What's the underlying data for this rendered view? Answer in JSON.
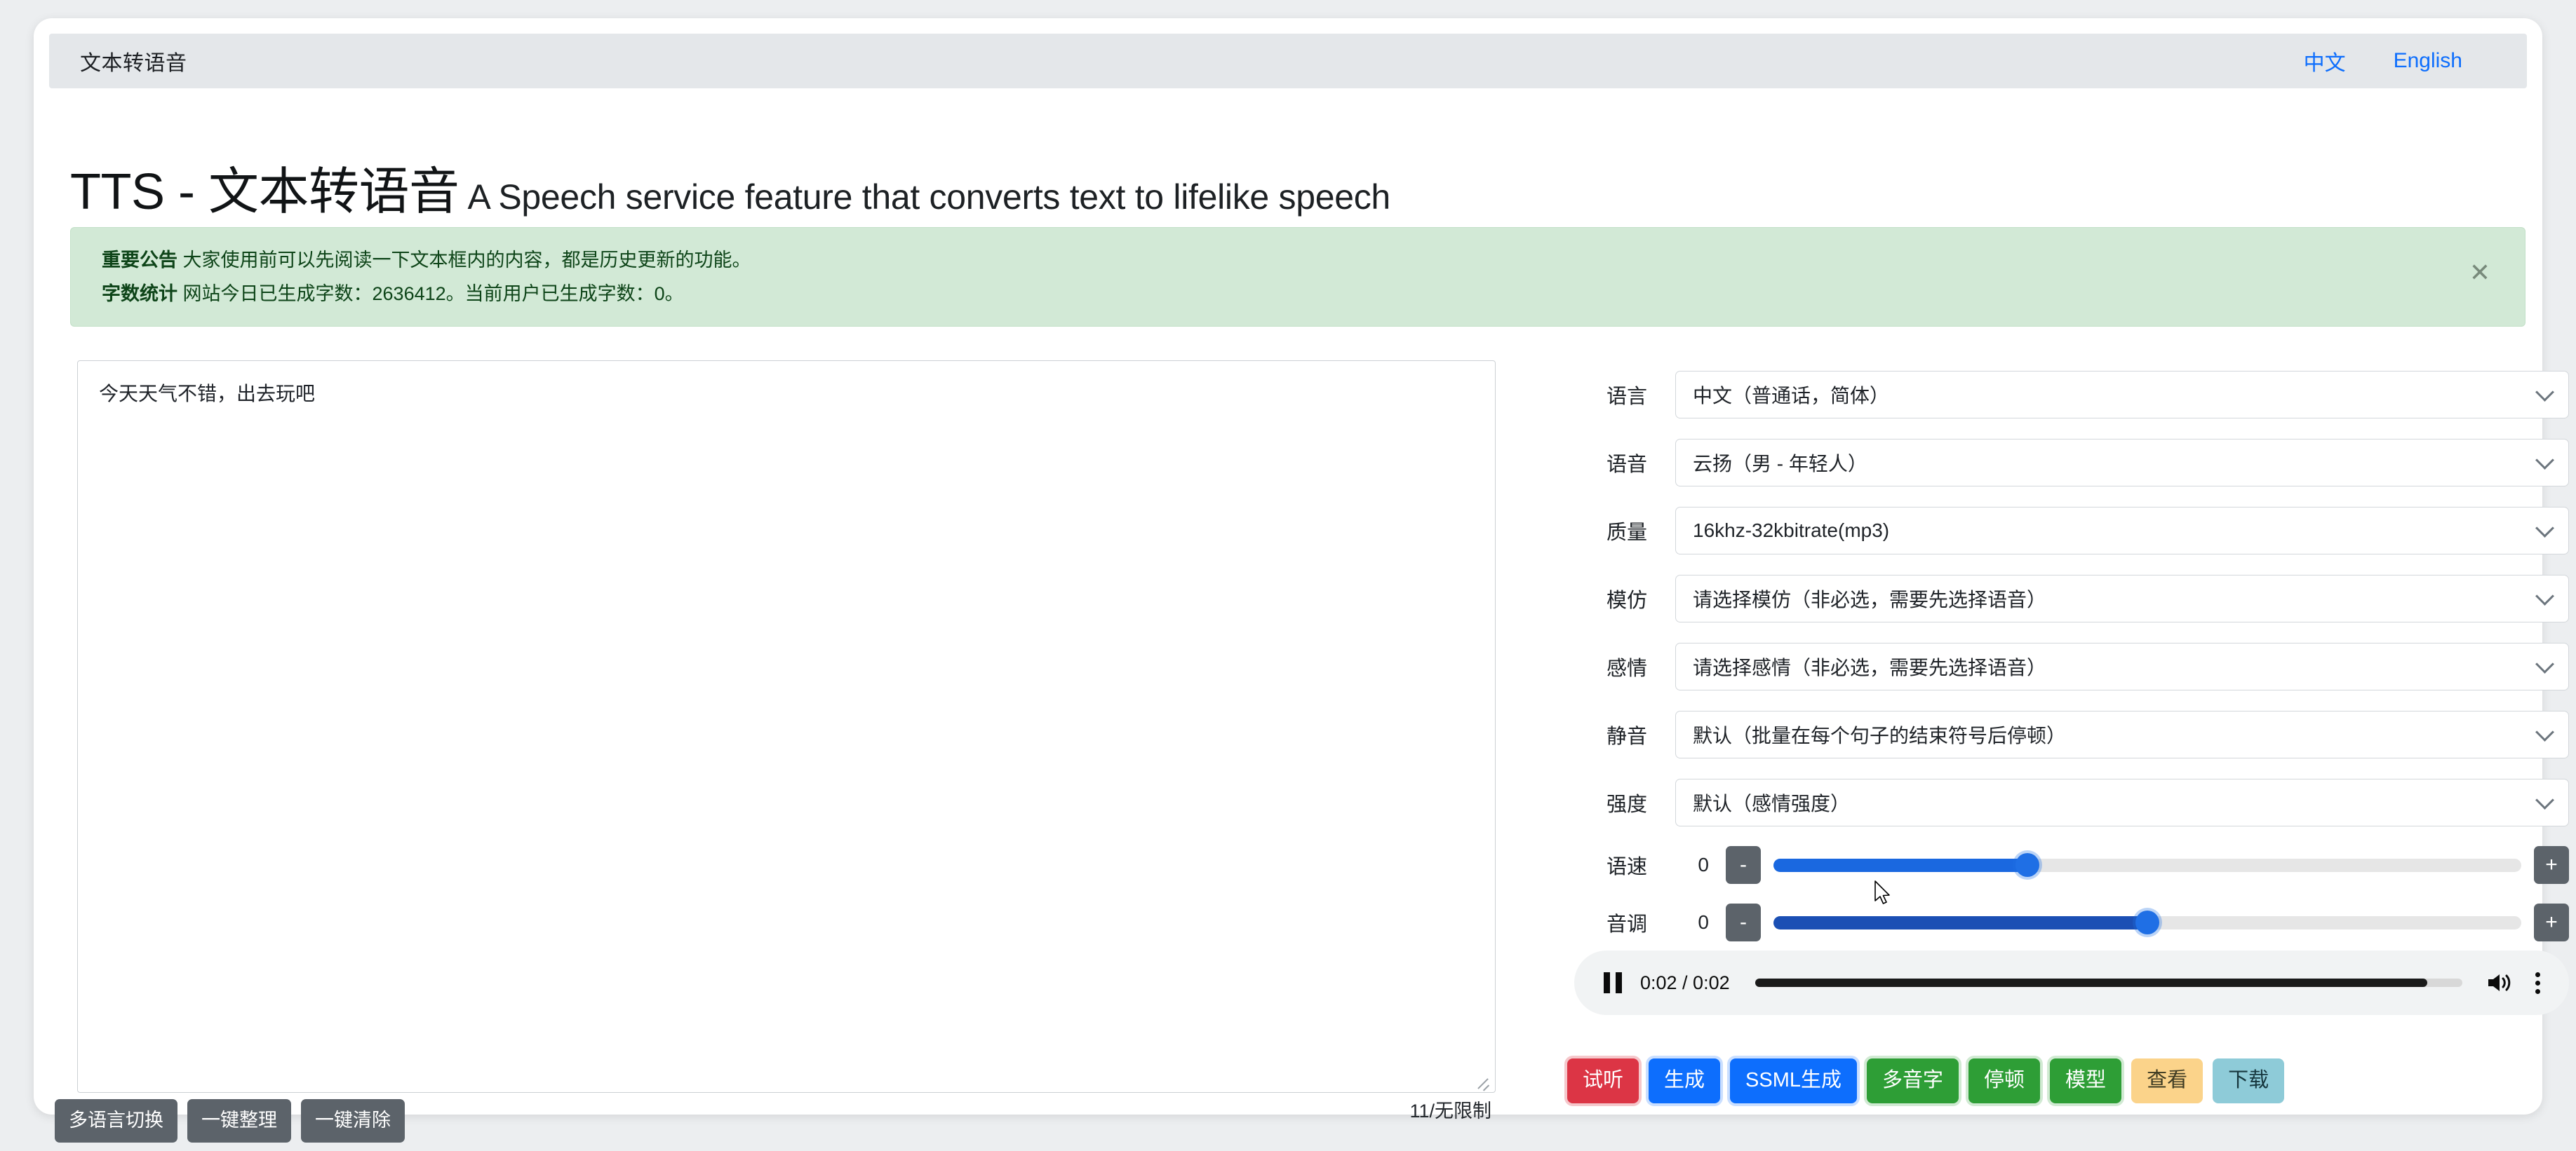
{
  "navbar": {
    "brand": "文本转语音",
    "links": [
      {
        "label": "中文"
      },
      {
        "label": "English"
      }
    ]
  },
  "heading": {
    "main": "TTS - 文本转语音",
    "sub": "A Speech service feature that converts text to lifelike speech"
  },
  "alert": {
    "line1_strong": "重要公告",
    "line1_text": "大家使用前可以先阅读一下文本框内的内容，都是历史更新的功能。",
    "line2_strong": "字数统计",
    "line2_text": "网站今日已生成字数：2636412。当前用户已生成字数：0。",
    "close_label": "✕",
    "background_color": "#d2e9d6"
  },
  "editor": {
    "text_value": "今天天气不错，出去玩吧",
    "placeholder": "",
    "char_counter": "11/无限制",
    "tools": [
      {
        "label": "多语言切换"
      },
      {
        "label": "一键整理"
      },
      {
        "label": "一键清除"
      }
    ]
  },
  "controls": {
    "selects": [
      {
        "label": "语言",
        "value": "中文（普通话，简体）"
      },
      {
        "label": "语音",
        "value": "云扬（男 - 年轻人）"
      },
      {
        "label": "质量",
        "value": "16khz-32kbitrate(mp3)"
      },
      {
        "label": "模仿",
        "value": "请选择模仿（非必选，需要先选择语音）"
      },
      {
        "label": "感情",
        "value": "请选择感情（非必选，需要先选择语音）"
      },
      {
        "label": "静音",
        "value": "默认（批量在每个句子的结束符号后停顿）"
      },
      {
        "label": "强度",
        "value": "默认（感情强度）"
      }
    ],
    "sliders": [
      {
        "label": "语速",
        "value": "0",
        "percent": 34,
        "minus_label": "-",
        "plus_label": "+"
      },
      {
        "label": "音调",
        "value": "0",
        "percent": 50,
        "minus_label": "-",
        "plus_label": "+"
      }
    ]
  },
  "audio": {
    "state": "playing",
    "time": "0:02 / 0:02",
    "progress_percent": 95
  },
  "actions": [
    {
      "label": "试听",
      "style": "btn-danger"
    },
    {
      "label": "生成",
      "style": "btn-primary"
    },
    {
      "label": "SSML生成",
      "style": "btn-primary"
    },
    {
      "label": "多音字",
      "style": "btn-success"
    },
    {
      "label": "停顿",
      "style": "btn-success"
    },
    {
      "label": "模型",
      "style": "btn-success"
    },
    {
      "label": "查看",
      "style": "btn-warning"
    },
    {
      "label": "下载",
      "style": "btn-info"
    }
  ]
}
